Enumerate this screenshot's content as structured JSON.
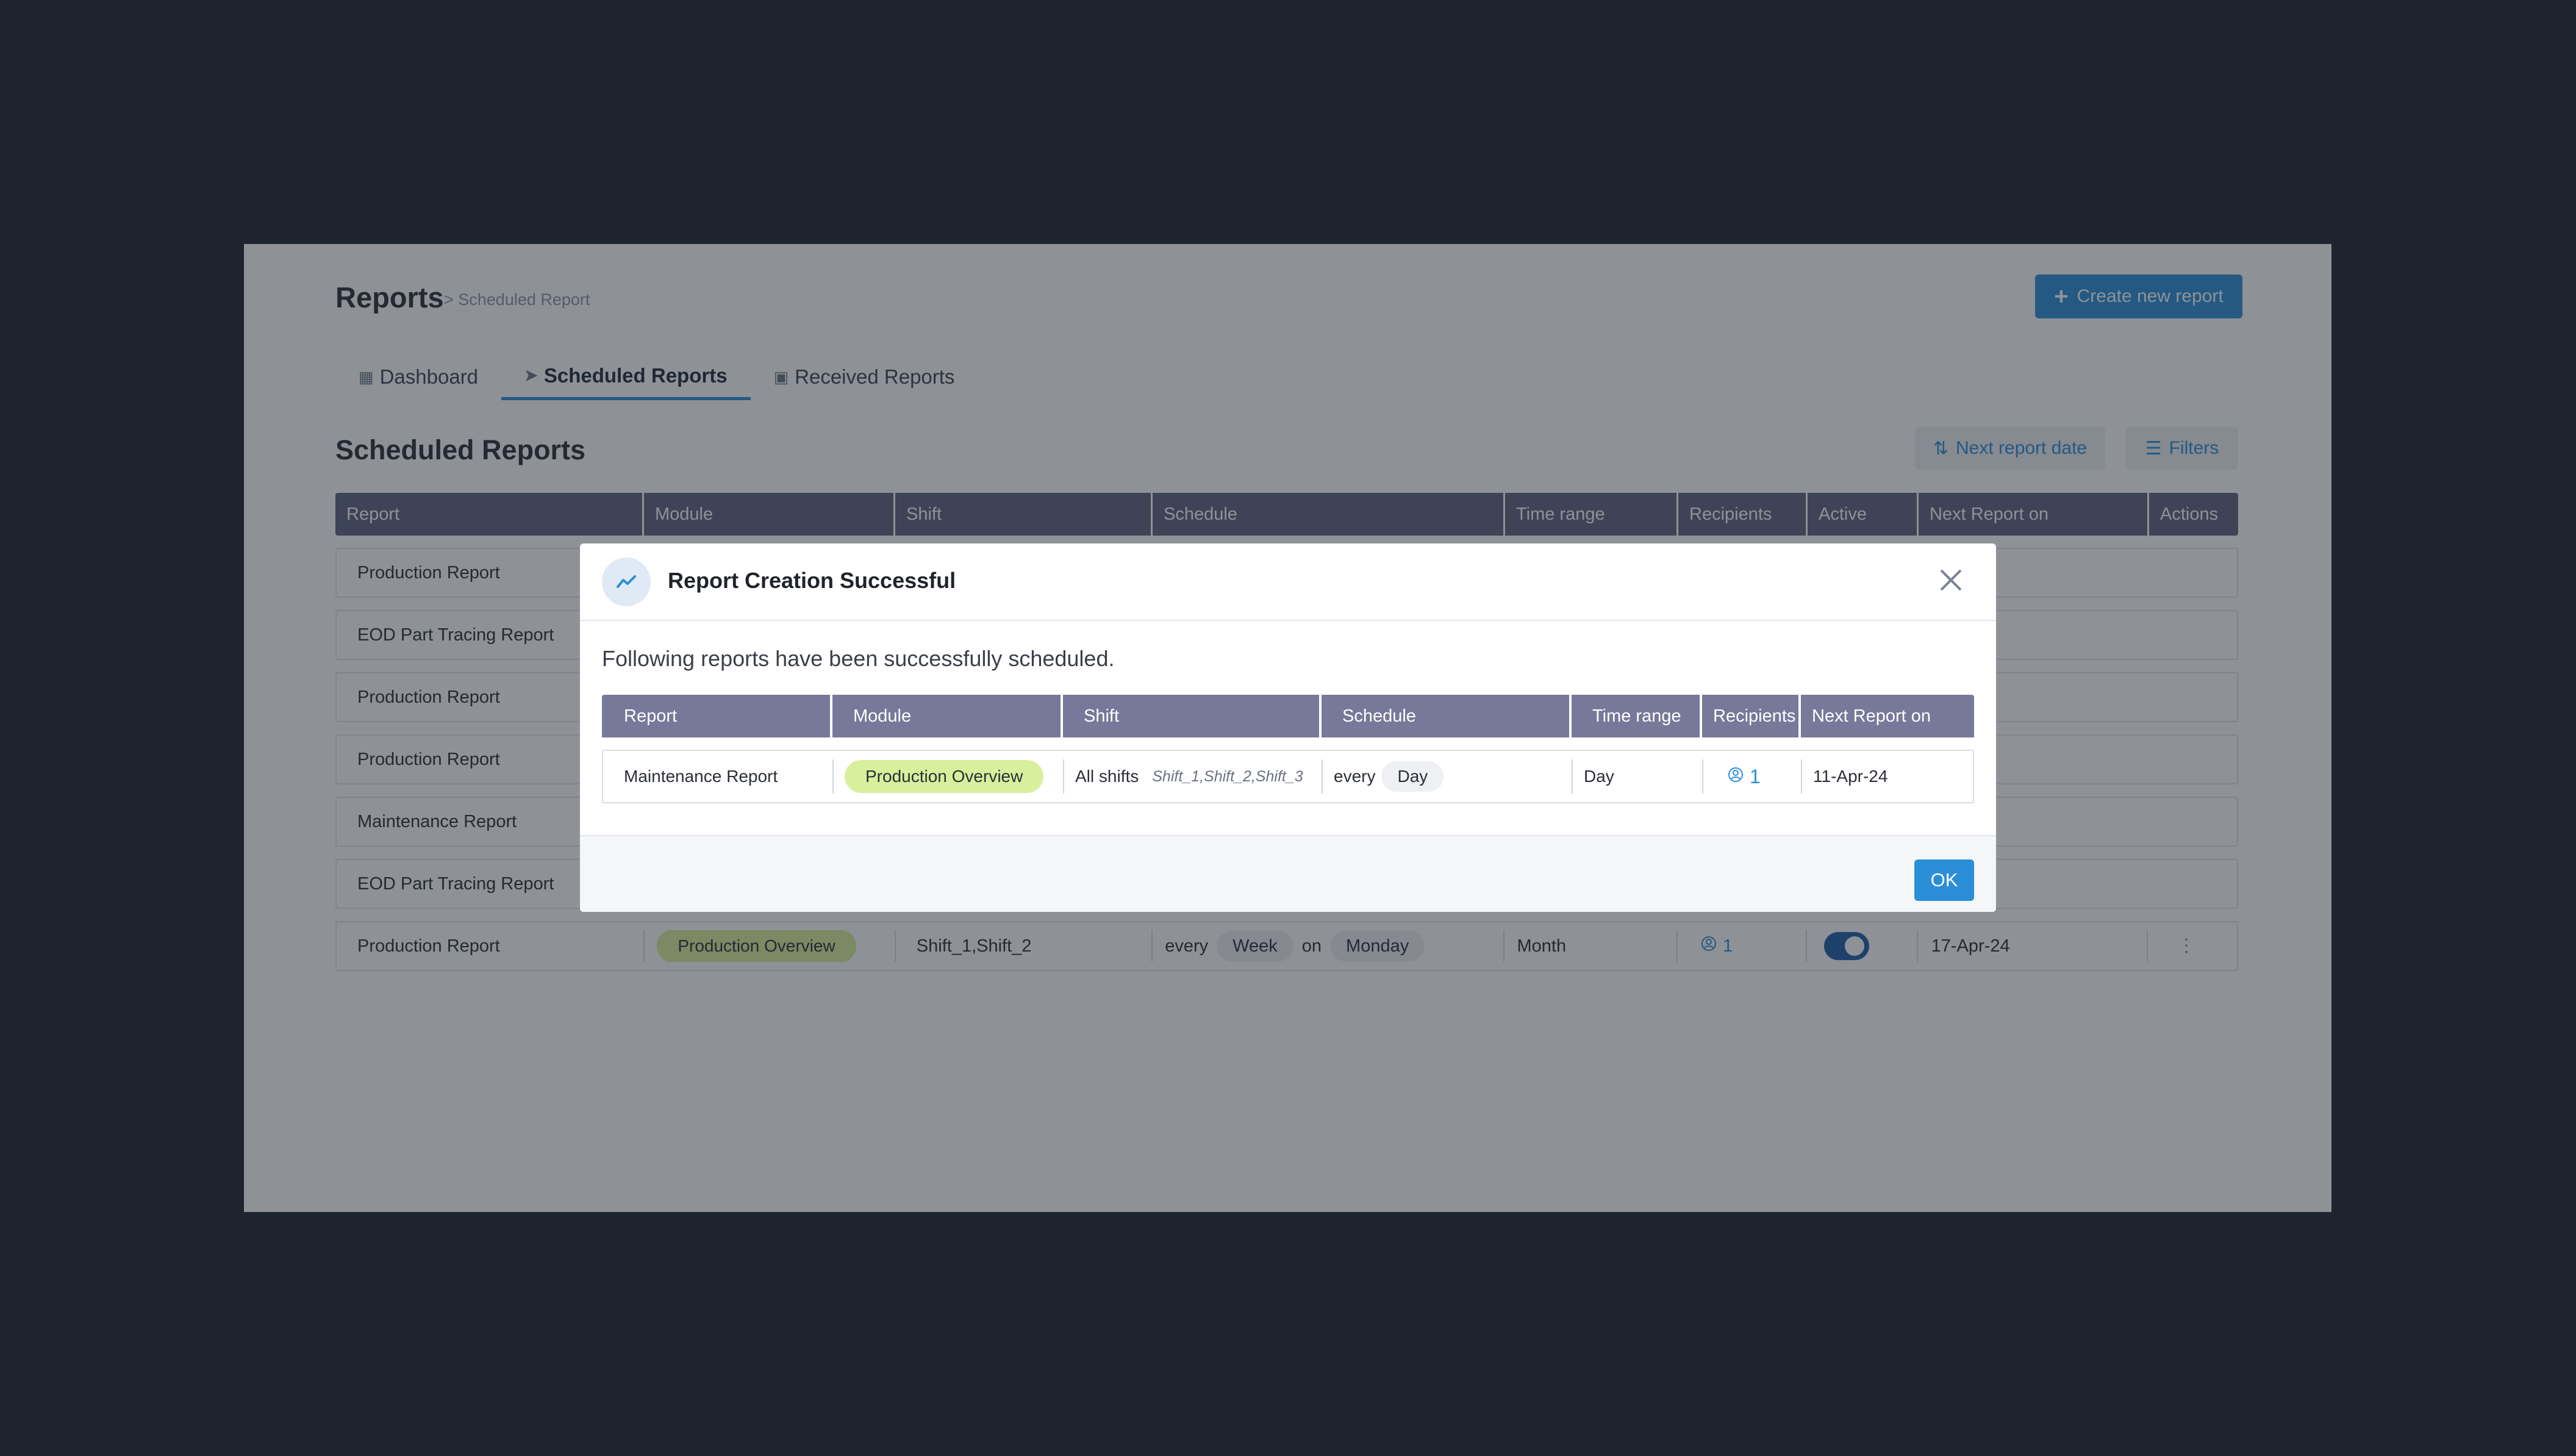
{
  "header": {
    "title": "Reports",
    "breadcrumb": "> Scheduled Report",
    "create_button": "Create new report"
  },
  "tabs": [
    {
      "label": "Dashboard",
      "icon": "dashboard-icon"
    },
    {
      "label": "Scheduled Reports",
      "icon": "send-icon",
      "active": true
    },
    {
      "label": "Received Reports",
      "icon": "inbox-icon"
    }
  ],
  "section": {
    "title": "Scheduled Reports",
    "next_report_button": "Next report date",
    "filters_button": "Filters"
  },
  "table": {
    "columns": [
      "Report",
      "Module",
      "Shift",
      "Schedule",
      "Time range",
      "Recipients",
      "Active",
      "Next Report on",
      "Actions"
    ],
    "rows": [
      {
        "report": "Production Report"
      },
      {
        "report": "EOD Part Tracing Report"
      },
      {
        "report": "Production Report"
      },
      {
        "report": "Production Report"
      },
      {
        "report": "Maintenance Report"
      },
      {
        "report": "EOD Part Tracing Report"
      },
      {
        "report": "Production Report",
        "module": "Production Overview",
        "shift": "Shift_1,Shift_2",
        "schedule_every": "every",
        "schedule_unit": "Week",
        "schedule_on": "on",
        "schedule_day": "Monday",
        "time_range": "Month",
        "recipients": "1",
        "next_report": "17-Apr-24"
      }
    ]
  },
  "modal": {
    "title": "Report Creation Successful",
    "message": "Following reports have been successfully scheduled.",
    "columns": [
      "Report",
      "Module",
      "Shift",
      "Schedule",
      "Time range",
      "Recipients",
      "Next Report on"
    ],
    "row": {
      "report": "Maintenance Report",
      "module": "Production Overview",
      "shift": "All shifts",
      "shift_detail": "Shift_1,Shift_2,Shift_3",
      "schedule_every": "every",
      "schedule_unit": "Day",
      "time_range": "Day",
      "recipients": "1",
      "next_report": "11-Apr-24"
    },
    "ok_button": "OK"
  },
  "colors": {
    "accent": "#2b8fd8",
    "module_pill": "#d8ef9c",
    "table_header": "#5f6380",
    "modal_table_header": "#77799a",
    "backdrop": "#1e242d"
  }
}
